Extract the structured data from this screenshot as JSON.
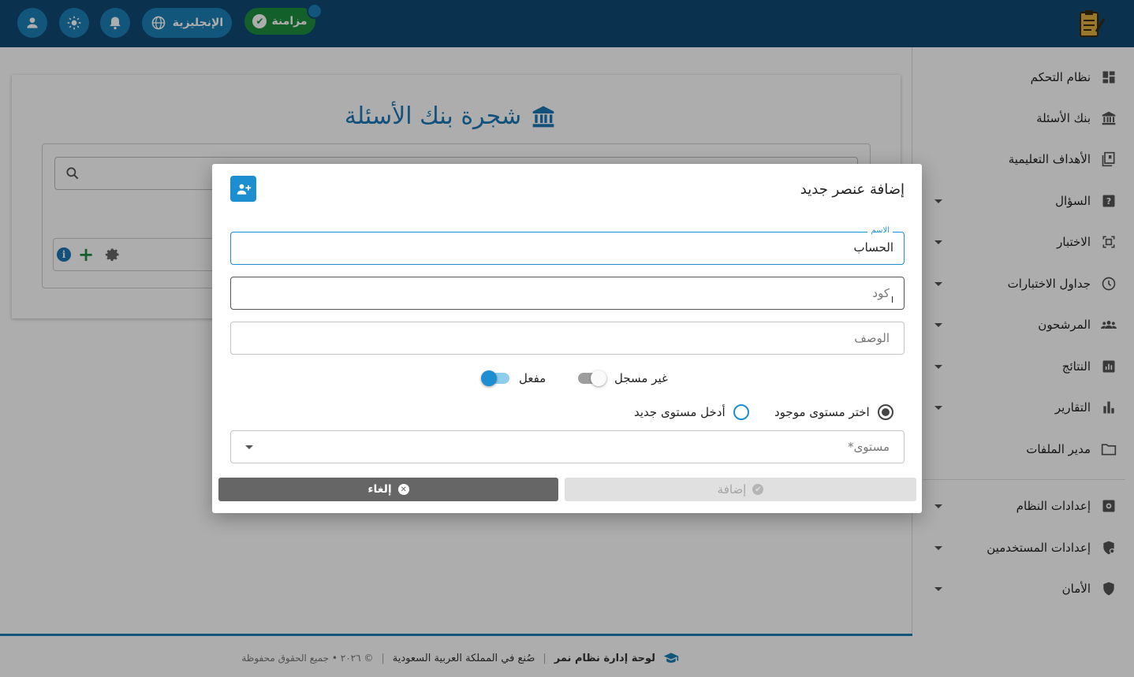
{
  "header": {
    "sync_label": "مزامنة",
    "language_label": "الإنجليزية"
  },
  "page": {
    "title": "شجرة بنك الأسئلة"
  },
  "sidebar": {
    "items": [
      {
        "label": "نظام التحكم",
        "icon": "dashboard-icon",
        "has_caret": false
      },
      {
        "label": "بنك الأسئلة",
        "icon": "bank-icon",
        "has_caret": false
      },
      {
        "label": "الأهداف التعليمية",
        "icon": "objectives-icon",
        "has_caret": false
      },
      {
        "label": "السؤال",
        "icon": "question-icon",
        "has_caret": true
      },
      {
        "label": "الاختبار",
        "icon": "exam-icon",
        "has_caret": true
      },
      {
        "label": "جداول الاختبارات",
        "icon": "clock-icon",
        "has_caret": true
      },
      {
        "label": "المرشحون",
        "icon": "people-icon",
        "has_caret": true
      },
      {
        "label": "النتائج",
        "icon": "results-icon",
        "has_caret": true
      },
      {
        "label": "التقارير",
        "icon": "bar-chart-icon",
        "has_caret": true
      },
      {
        "label": "مدير الملفات",
        "icon": "folder-icon",
        "has_caret": false
      },
      {
        "label": "إعدادات النظام",
        "icon": "gear-icon",
        "has_caret": true
      },
      {
        "label": "إعدادات المستخدمين",
        "icon": "user-shield-icon",
        "has_caret": true
      },
      {
        "label": "الأمان",
        "icon": "shield-icon",
        "has_caret": true
      }
    ]
  },
  "footer": {
    "brand": "لوحة إدارة نظام نمر",
    "made_in": "صُنع في المملكة العربية السعودية",
    "copyright": "© ٢٠٢٦ • جميع الحقوق محفوظة"
  },
  "dialog": {
    "title": "إضافة عنصر جديد",
    "name_legend": "الاسم",
    "name_value": "الحساب",
    "code_placeholder": "كود",
    "description_placeholder": "الوصف",
    "toggle_registered_label": "غير مسجل",
    "toggle_enabled_label": "مفعل",
    "radio_existing_label": "اختر مستوى موجود",
    "radio_new_label": "أدخل مستوى جديد",
    "level_placeholder": "مستوى*",
    "cancel_label": "إلغاء",
    "add_label": "إضافة"
  },
  "colors": {
    "topbar": "#0f4a74",
    "accent": "#1d8fd1",
    "sync_green": "#1e8e3e"
  }
}
